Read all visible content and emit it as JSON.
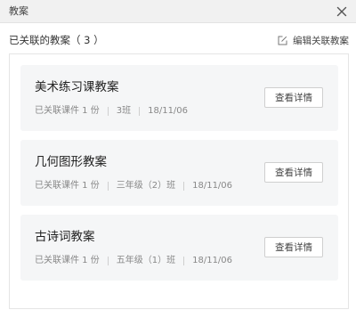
{
  "window": {
    "title": "教案",
    "close_icon": "close-icon"
  },
  "header": {
    "count_label": "已关联的教案（ 3 ）",
    "edit_label": "编辑关联教案",
    "edit_icon": "edit-icon"
  },
  "cards": [
    {
      "name": "美术练习课教案",
      "courseware": "已关联课件 1 份",
      "class": "3班",
      "date": "18/11/06",
      "button": "查看详情"
    },
    {
      "name": "几何图形教案",
      "courseware": "已关联课件 1 份",
      "class": "三年级（2）班",
      "date": "18/11/06",
      "button": "查看详情"
    },
    {
      "name": "古诗词教案",
      "courseware": "已关联课件 1 份",
      "class": "五年级（1）班",
      "date": "18/11/06",
      "button": "查看详情"
    }
  ]
}
